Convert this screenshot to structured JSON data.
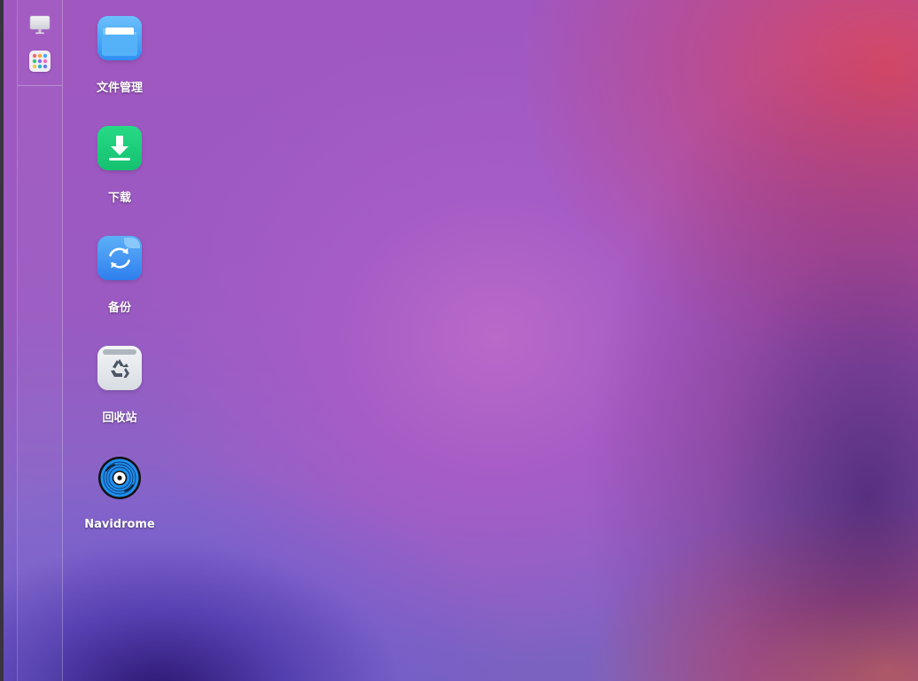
{
  "desktop": {
    "icons": [
      {
        "label": "文件管理",
        "icon": "folder-icon",
        "color": "#4aa8f7"
      },
      {
        "label": "下载",
        "icon": "download-icon",
        "color": "#1fcf7e"
      },
      {
        "label": "备份",
        "icon": "backup-sync-icon",
        "color": "#3f93f4"
      },
      {
        "label": "回收站",
        "icon": "recycle-bin-icon",
        "color": "#e4e8ec"
      },
      {
        "label": "Navidrome",
        "icon": "vinyl-disc-icon",
        "color": "#1f7fe6"
      }
    ]
  },
  "dock": {
    "items": [
      {
        "icon": "monitor-icon"
      },
      {
        "icon": "app-grid-icon"
      }
    ]
  }
}
